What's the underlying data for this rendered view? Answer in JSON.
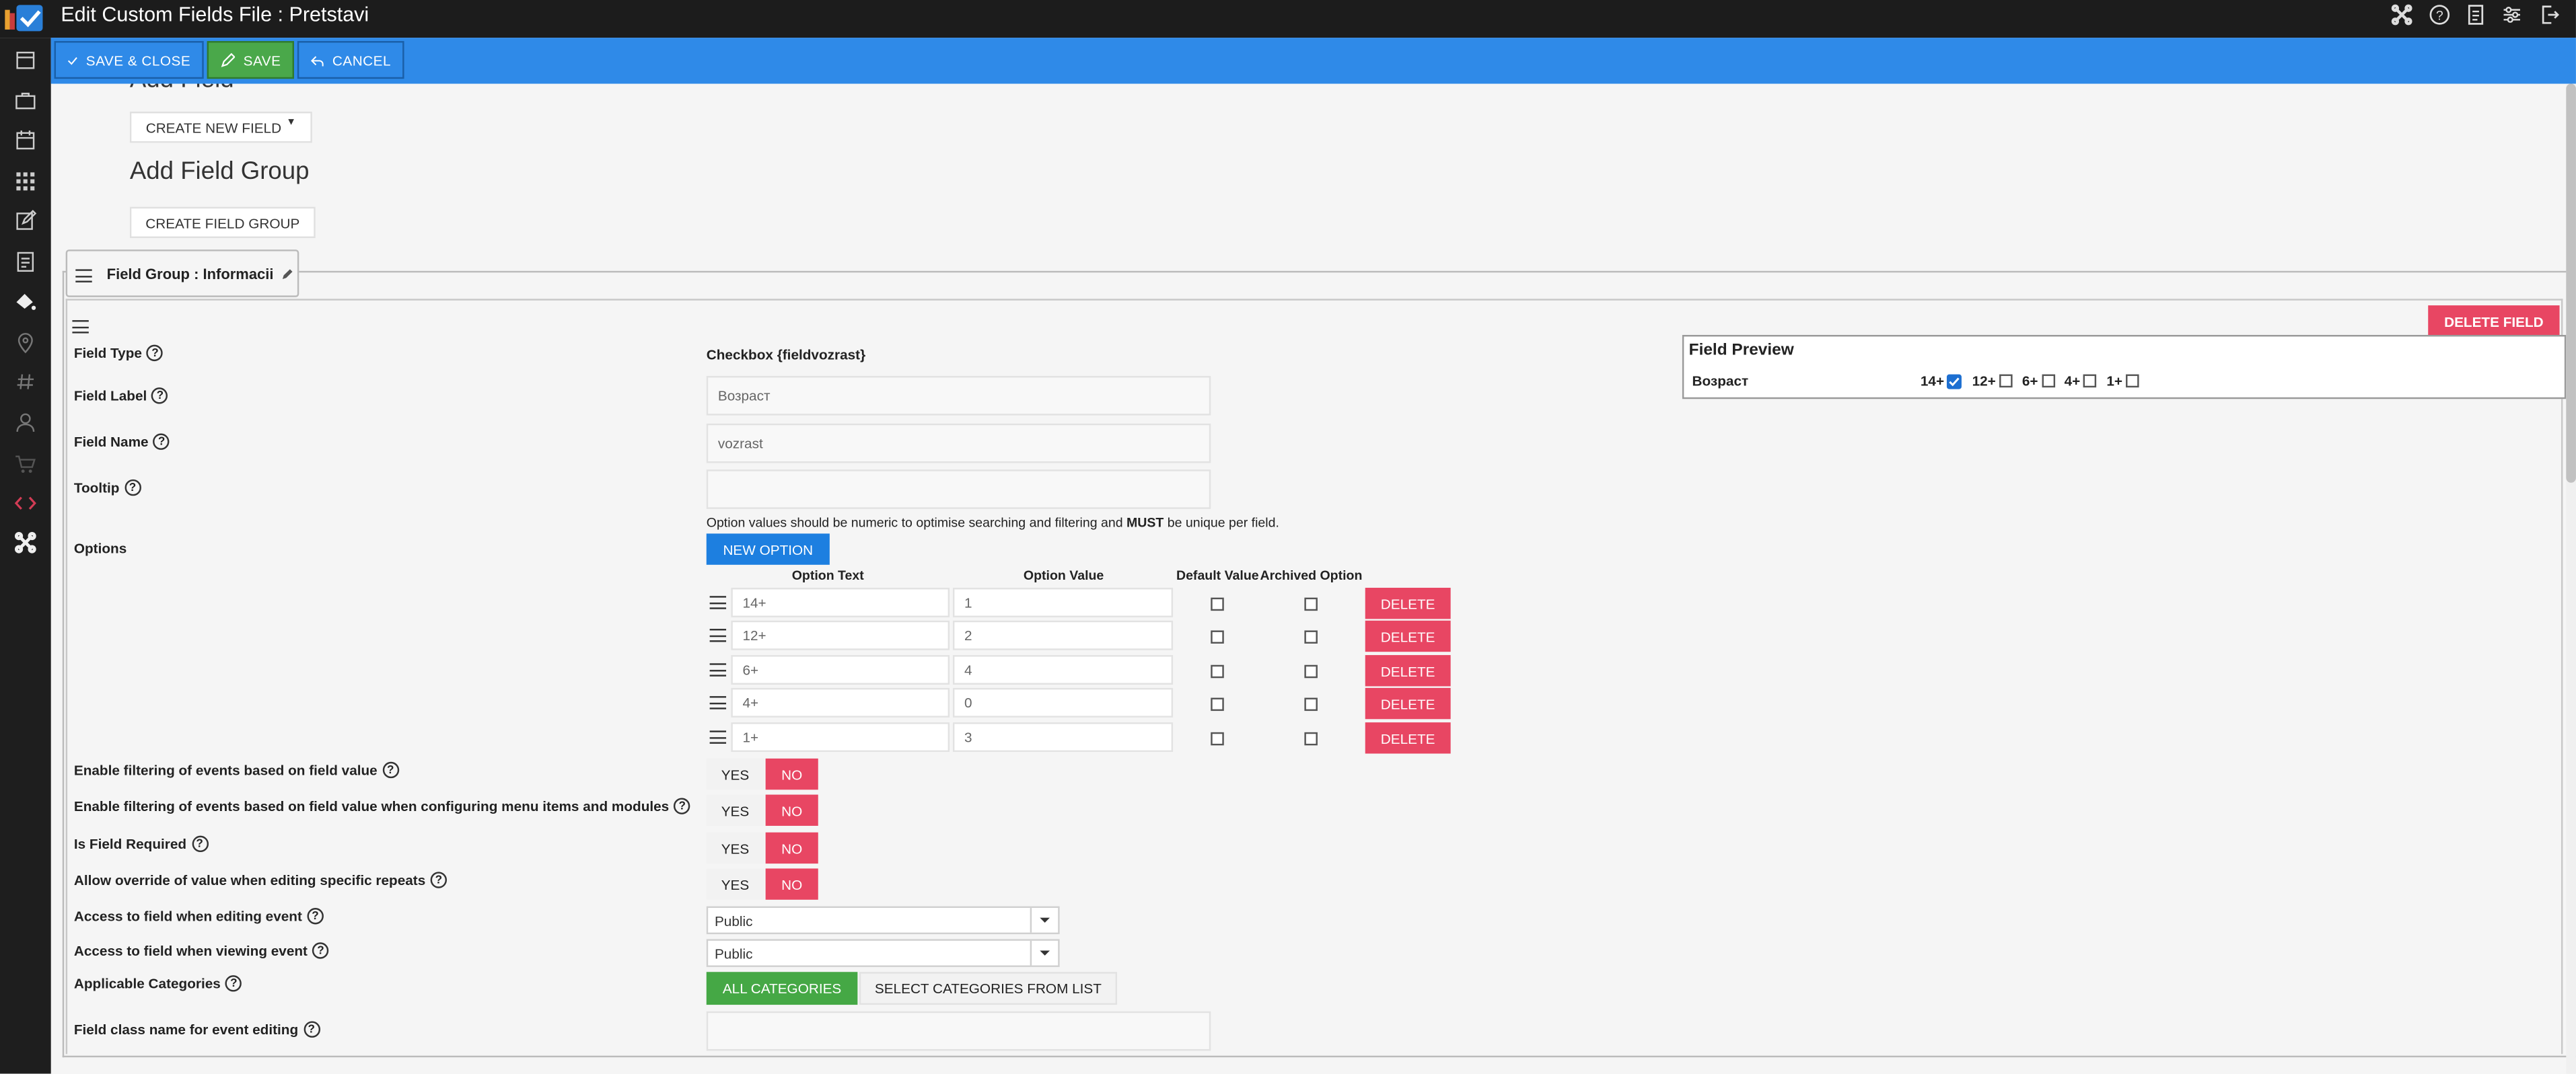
{
  "window": {
    "title": "Edit Custom Fields File : Pretstavi"
  },
  "toolbar": {
    "save_close": "SAVE & CLOSE",
    "save": "SAVE",
    "cancel": "CANCEL"
  },
  "top_icons": [
    "joomla-icon",
    "help-icon",
    "document-icon",
    "sliders-icon",
    "logout-icon"
  ],
  "sidebar_icons": [
    "calendar-icon",
    "briefcase-icon",
    "calendar-alt-icon",
    "grid-icon",
    "edit-icon",
    "file-icon",
    "paint-bucket-icon",
    "map-pin-icon",
    "hash-icon",
    "user-icon",
    "cart-icon",
    "code-icon",
    "joomla-icon"
  ],
  "add_field": {
    "heading_partial": "Add Field",
    "create_new_field": "CREATE NEW FIELD"
  },
  "add_field_group": {
    "heading": "Add Field Group",
    "create_field_group": "CREATE FIELD GROUP"
  },
  "field_group": {
    "tab_label": "Field Group : Informacii"
  },
  "field": {
    "delete_field": "DELETE FIELD",
    "type_label": "Field Type",
    "type_value": "Checkbox {fieldvozrast}",
    "label_label": "Field Label",
    "label_value": "Возраст",
    "name_label": "Field Name",
    "name_value": "vozrast",
    "tooltip_label": "Tooltip",
    "tooltip_value": "",
    "options_label": "Options",
    "options_note_1": "Option values should be numeric to optimise searching and filtering and ",
    "options_note_bold": "MUST",
    "options_note_2": " be unique per field.",
    "new_option": "NEW OPTION",
    "col_option_text": "Option Text",
    "col_option_value": "Option Value",
    "col_default_value": "Default Value",
    "col_archived_option": "Archived Option",
    "delete_label": "DELETE",
    "options": [
      {
        "text": "14+",
        "value": "1",
        "default": false,
        "archived": false
      },
      {
        "text": "12+",
        "value": "2",
        "default": false,
        "archived": false
      },
      {
        "text": "6+",
        "value": "4",
        "default": false,
        "archived": false
      },
      {
        "text": "4+",
        "value": "0",
        "default": false,
        "archived": false
      },
      {
        "text": "1+",
        "value": "3",
        "default": false,
        "archived": false
      }
    ],
    "yes_label": "YES",
    "no_label": "NO",
    "toggles": [
      {
        "label": "Enable filtering of events based on field value",
        "value": "NO"
      },
      {
        "label": "Enable filtering of events based on field value when configuring menu items and modules",
        "value": "NO"
      },
      {
        "label": "Is Field Required",
        "value": "NO"
      },
      {
        "label": "Allow override of value when editing specific repeats",
        "value": "NO"
      }
    ],
    "access_edit_label": "Access to field when editing event",
    "access_edit_value": "Public",
    "access_view_label": "Access to field when viewing event",
    "access_view_value": "Public",
    "categories_label": "Applicable Categories",
    "all_categories": "ALL CATEGORIES",
    "select_categories": "SELECT CATEGORIES FROM LIST",
    "classname_label": "Field class name for event editing",
    "classname_value": ""
  },
  "preview": {
    "title": "Field Preview",
    "label": "Возраст",
    "options": [
      {
        "text": "14+",
        "checked": true
      },
      {
        "text": "12+",
        "checked": false
      },
      {
        "text": "6+",
        "checked": false
      },
      {
        "text": "4+",
        "checked": false
      },
      {
        "text": "1+",
        "checked": false
      }
    ]
  },
  "colors": {
    "topbar": "#1c1c1c",
    "toolbar": "#2f8ae8",
    "save_green": "#4aa84a",
    "danger": "#e84663",
    "primary": "#1d7fe0",
    "success": "#45a845"
  }
}
